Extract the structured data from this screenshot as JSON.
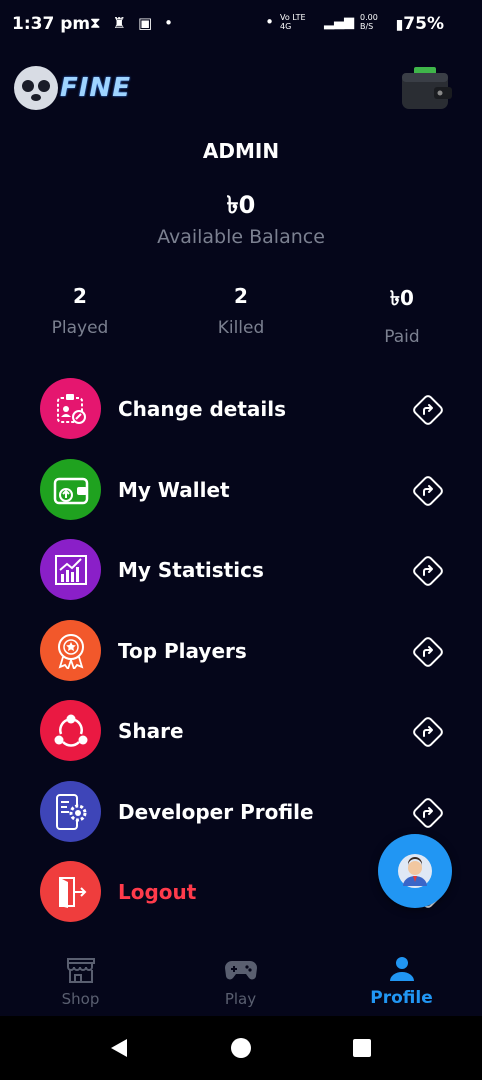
{
  "status_bar": {
    "time": "1:37 pm",
    "network": "Vo LTE 4G",
    "speed": "0.00 B/S",
    "battery": "75%"
  },
  "header": {
    "logo_text": "FINE",
    "wallet_icon": "wallet-icon"
  },
  "profile": {
    "username": "ADMIN",
    "balance": "৳0",
    "balance_label": "Available Balance"
  },
  "stats": [
    {
      "value": "2",
      "label": "Played"
    },
    {
      "value": "2",
      "label": "Killed"
    },
    {
      "value": "৳0",
      "label": "Paid"
    }
  ],
  "menu": [
    {
      "label": "Change details",
      "icon": "id-card-edit-icon",
      "color": "#e5166f"
    },
    {
      "label": "My Wallet",
      "icon": "wallet-money-icon",
      "color": "#1fa21f"
    },
    {
      "label": "My Statistics",
      "icon": "bar-chart-icon",
      "color": "#8a1fc8"
    },
    {
      "label": "Top Players",
      "icon": "award-badge-icon",
      "color": "#f2582b"
    },
    {
      "label": "Share",
      "icon": "share-icon",
      "color": "#ea1942"
    },
    {
      "label": "Developer Profile",
      "icon": "developer-settings-icon",
      "color": "#3e45b8"
    },
    {
      "label": "Logout",
      "icon": "logout-door-icon",
      "color": "#ef3d3d"
    }
  ],
  "fab": {
    "icon": "support-agent-icon",
    "color": "#2196f3"
  },
  "bottom_nav": [
    {
      "label": "Shop",
      "icon": "store-icon"
    },
    {
      "label": "Play",
      "icon": "gamepad-icon"
    },
    {
      "label": "Profile",
      "icon": "person-icon",
      "active": true
    }
  ]
}
